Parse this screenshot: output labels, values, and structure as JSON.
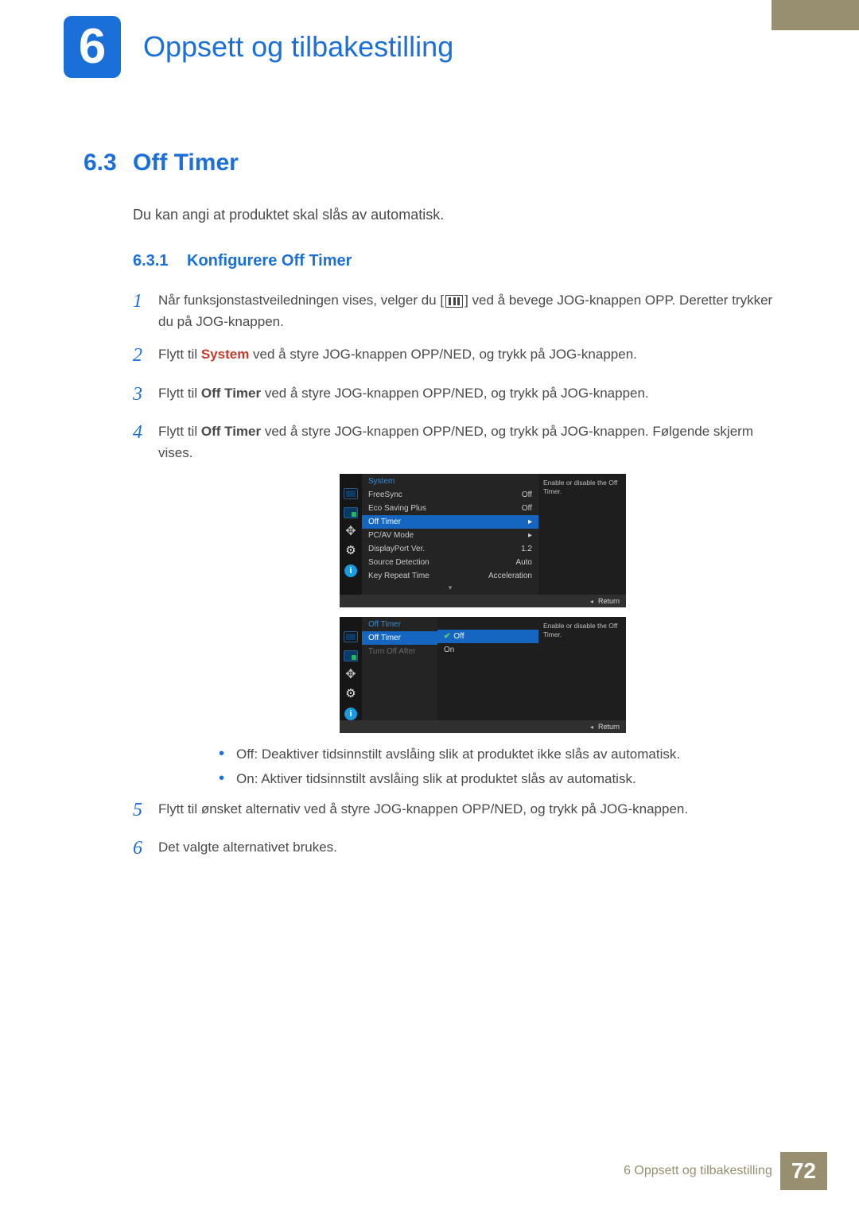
{
  "chapter": {
    "number": "6",
    "title": "Oppsett og tilbakestilling"
  },
  "section": {
    "number": "6.3",
    "title": "Off Timer"
  },
  "intro": "Du kan angi at produktet skal slås av automatisk.",
  "subsection": {
    "number": "6.3.1",
    "title": "Konfigurere Off Timer"
  },
  "steps": {
    "s1a": "Når funksjonstastveiledningen vises, velger du [",
    "s1b": "] ved å bevege JOG-knappen OPP. Deretter trykker du på JOG-knappen.",
    "s2a": "Flytt til ",
    "s2_sys": "System",
    "s2b": " ved å styre JOG-knappen OPP/NED, og trykk på JOG-knappen.",
    "s3a": "Flytt til ",
    "s3_ot": "Off Timer",
    "s3b": " ved å styre JOG-knappen OPP/NED, og trykk på JOG-knappen.",
    "s4a": "Flytt til ",
    "s4_ot": "Off Timer",
    "s4b": " ved å styre JOG-knappen OPP/NED, og trykk på JOG-knappen. Følgende skjerm vises.",
    "s5": "Flytt til ønsket alternativ ved å styre JOG-knappen OPP/NED, og trykk på JOG-knappen.",
    "s6": "Det valgte alternativet brukes."
  },
  "osd1": {
    "header": "System",
    "rows": [
      {
        "label": "FreeSync",
        "val": "Off"
      },
      {
        "label": "Eco Saving Plus",
        "val": "Off"
      },
      {
        "label": "Off Timer",
        "val": "▸",
        "selected": true
      },
      {
        "label": "PC/AV Mode",
        "val": "▸"
      },
      {
        "label": "DisplayPort Ver.",
        "val": "1.2"
      },
      {
        "label": "Source Detection",
        "val": "Auto"
      },
      {
        "label": "Key Repeat Time",
        "val": "Acceleration"
      }
    ],
    "help": "Enable or disable the Off Timer.",
    "return": "Return"
  },
  "osd2": {
    "header": "Off Timer",
    "left": [
      {
        "label": "Off Timer",
        "selected": true
      },
      {
        "label": "Turn Off After",
        "dim": true
      }
    ],
    "opts": [
      {
        "label": "Off",
        "selected": true,
        "checked": true
      },
      {
        "label": "On"
      }
    ],
    "help": "Enable or disable the Off Timer.",
    "return": "Return"
  },
  "bullets": {
    "off_label": "Off",
    "off_text": ": Deaktiver tidsinnstilt avslåing slik at produktet ikke slås av automatisk.",
    "on_label": "On",
    "on_text": ": Aktiver tidsinnstilt avslåing slik at produktet slås av automatisk."
  },
  "footer": {
    "text": "6 Oppsett og tilbakestilling",
    "page": "72"
  }
}
